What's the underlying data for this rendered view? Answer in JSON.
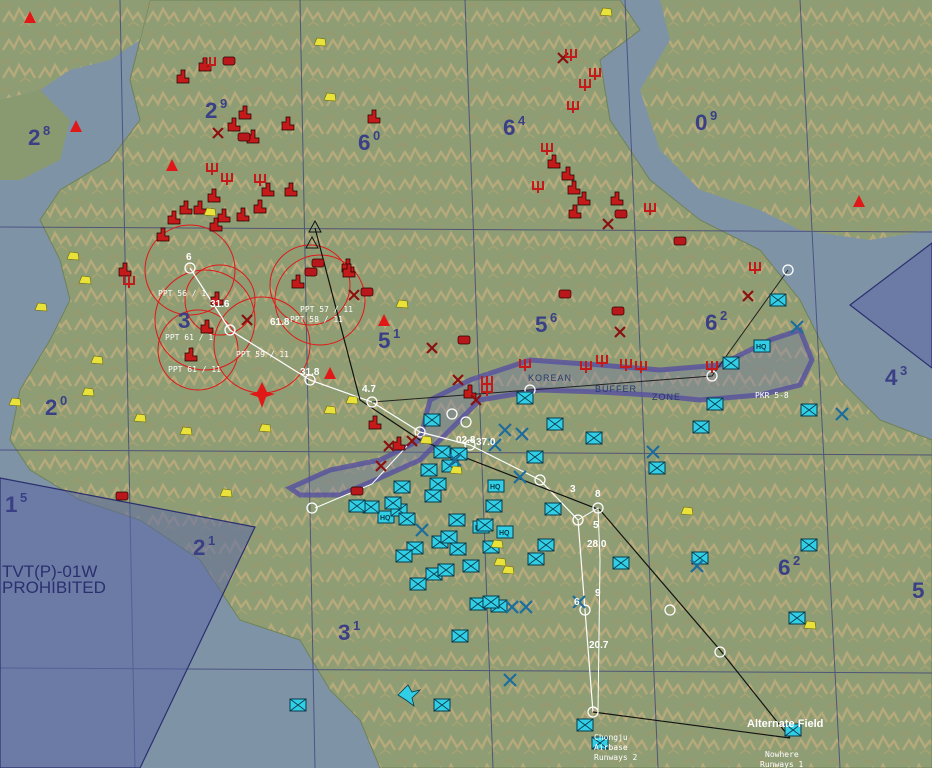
{
  "sectors": [
    {
      "main": "2",
      "sup": "8"
    },
    {
      "main": "2",
      "sup": "9"
    },
    {
      "main": "6",
      "sup": "0"
    },
    {
      "main": "6",
      "sup": "4"
    },
    {
      "main": "0",
      "sup": "9"
    },
    {
      "main": "3",
      "sup": ""
    },
    {
      "main": "5",
      "sup": "1"
    },
    {
      "main": "5",
      "sup": "6"
    },
    {
      "main": "6",
      "sup": "2"
    },
    {
      "main": "2",
      "sup": "0"
    },
    {
      "main": "4",
      "sup": "3"
    },
    {
      "main": "1",
      "sup": "5"
    },
    {
      "main": "2",
      "sup": "1"
    },
    {
      "main": "3",
      "sup": "1"
    },
    {
      "main": "6",
      "sup": "2"
    },
    {
      "main": "5",
      "sup": ""
    }
  ],
  "restricted_area": {
    "line1": "TVT(P)-01W",
    "line2": "PROHIBITED"
  },
  "buffer_zone": {
    "word1": "KOREAN",
    "word2": "BUFFER",
    "word3": "ZONE"
  },
  "waypoint_labels": [
    "31.6",
    "61.8",
    "31.8",
    "4.7",
    "02.8",
    "37.0",
    "3",
    "8",
    "28.0",
    "9",
    "20.7",
    "6",
    "5",
    "6"
  ],
  "ppt_labels": [
    "PPT 56 / 1",
    "PPT 61 / 1",
    "PPT 61 / 11",
    "PPT 59 / 11",
    "PPT 57 / 11",
    "PPT 58 / 11",
    "PKR 5-8"
  ],
  "airfields": {
    "chongju": {
      "l1": "Chongju",
      "l2": "Airbase",
      "l3": "Runways 2"
    },
    "alternate": {
      "title": "Alternate Field",
      "l1": "Nowhere",
      "l2": "Runways 1"
    }
  },
  "unit_tag": "HQ",
  "colors": {
    "sea": "#7f93a6",
    "land": "#8d9d72",
    "mountain": "#c4b07e",
    "enemy": "#c41a1a",
    "friendly": "#30cfe6",
    "flight_path": "#ffffff",
    "threat_ring": "#e01818",
    "sector_text": "#3a3f86",
    "zone_fill": "#5b67a6"
  }
}
